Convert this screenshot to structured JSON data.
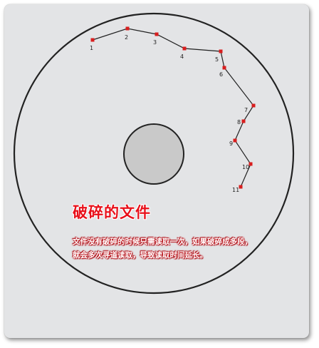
{
  "title": "破碎的文件",
  "description_lines": [
    "文件没有破碎的时候只需读取一次，如果破碎成多段，",
    "就会多次寻道读取，导致读取时间延长。"
  ],
  "segments": [
    "1",
    "2",
    "3",
    "4",
    "5",
    "6",
    "7",
    "8",
    "9",
    "10",
    "11"
  ],
  "colors": {
    "background": "#e3e4e6",
    "disk_outline": "#222222",
    "hub_fill": "#c9c9c9",
    "segment_marker": "#d81e1e",
    "title": "#e8101a",
    "description_glow": "#c2121a"
  }
}
